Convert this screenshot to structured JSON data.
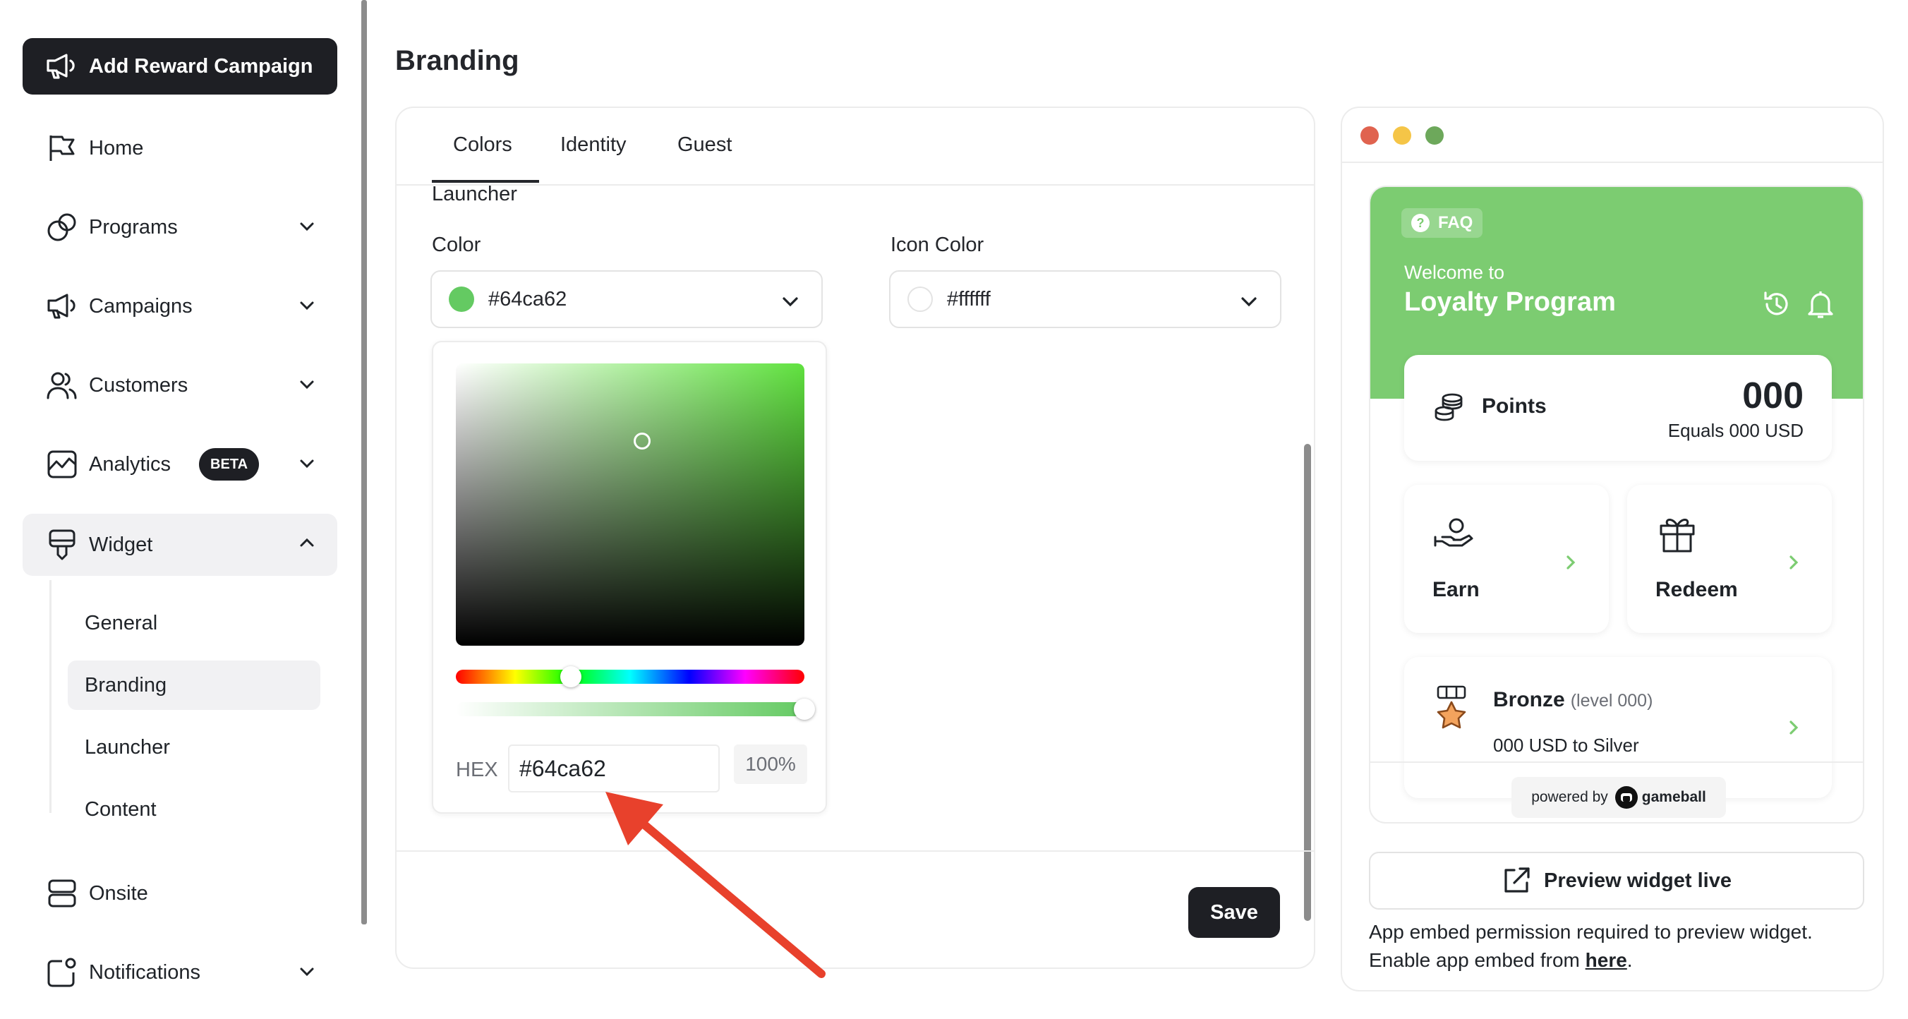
{
  "sidebar": {
    "add_campaign": "Add Reward Campaign",
    "items": [
      {
        "label": "Home"
      },
      {
        "label": "Programs"
      },
      {
        "label": "Campaigns"
      },
      {
        "label": "Customers"
      },
      {
        "label": "Analytics",
        "badge": "BETA"
      },
      {
        "label": "Widget"
      },
      {
        "label": "Onsite"
      },
      {
        "label": "Notifications"
      }
    ],
    "widget_sub": [
      {
        "label": "General"
      },
      {
        "label": "Branding"
      },
      {
        "label": "Launcher"
      },
      {
        "label": "Content"
      }
    ]
  },
  "main": {
    "title": "Branding",
    "tabs": [
      {
        "label": "Colors"
      },
      {
        "label": "Identity"
      },
      {
        "label": "Guest"
      }
    ],
    "section": "Launcher",
    "color_label": "Color",
    "color_value": "#64ca62",
    "icon_color_label": "Icon Color",
    "icon_color_value": "#ffffff",
    "picker": {
      "hex_label": "HEX",
      "hex_value": "#64ca62",
      "alpha": "100%",
      "hue_fraction": 0.33,
      "alpha_fraction": 1.0
    },
    "save": "Save"
  },
  "preview": {
    "faq": "FAQ",
    "welcome": "Welcome to",
    "program": "Loyalty Program",
    "points_label": "Points",
    "points_value": "000",
    "points_equals": "Equals 000 USD",
    "earn": "Earn",
    "redeem": "Redeem",
    "tier": "Bronze",
    "tier_level": "(level 000)",
    "tier_next": "000 USD to Silver",
    "powered_by": "powered by",
    "brand": "gameball",
    "preview_button": "Preview widget live",
    "embed_note_1": "App embed permission required to preview widget.",
    "embed_note_2": "Enable app embed from ",
    "embed_link": "here",
    "embed_end": "."
  },
  "colors": {
    "widget_header": "#7ccc71",
    "accent_green": "#64ca62",
    "dark_button": "#1e1f24",
    "traffic_red": "#e0634f",
    "traffic_yellow": "#f5c547",
    "traffic_green": "#6da85b",
    "annotation_arrow": "#e8412c"
  }
}
